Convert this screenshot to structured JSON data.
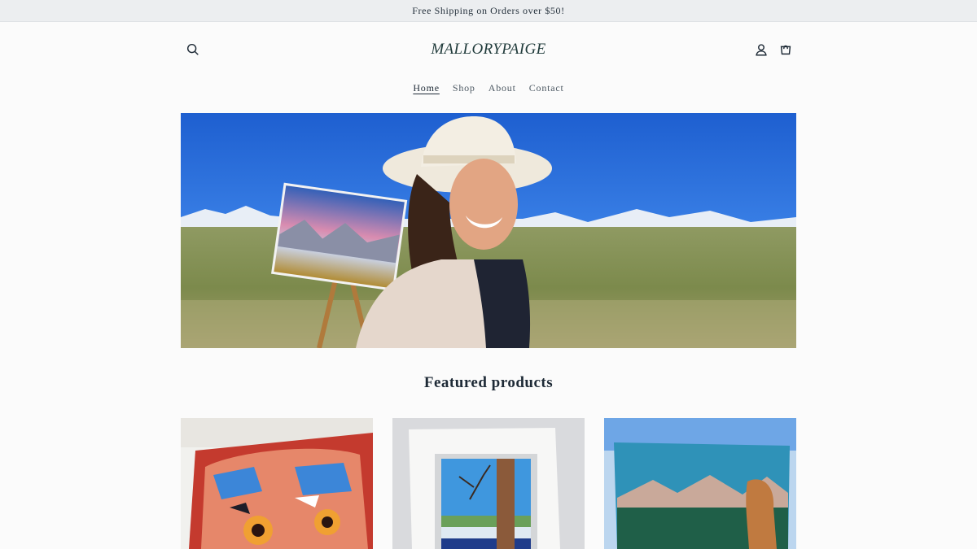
{
  "announcement": {
    "text": "Free Shipping on Orders over $50!"
  },
  "header": {
    "logo_text": "MALLORYPAIGE",
    "icons": {
      "search": "search-icon",
      "account": "account-icon",
      "cart": "cart-icon"
    }
  },
  "nav": {
    "items": [
      {
        "label": "Home",
        "active": true
      },
      {
        "label": "Shop",
        "active": false
      },
      {
        "label": "About",
        "active": false
      },
      {
        "label": "Contact",
        "active": false
      }
    ]
  },
  "hero": {
    "image": "Artist in white hat smiling in a field with a painting on an easel"
  },
  "featured": {
    "title": "Featured products",
    "products": [
      {
        "image": "Colorful owl painting"
      },
      {
        "image": "Birch tree painting in white mat"
      },
      {
        "image": "Mountain landscape painting"
      }
    ]
  },
  "colors": {
    "accent": "#1e2a36",
    "announcement_bg": "#eceef0",
    "background": "#fbfbfb"
  }
}
